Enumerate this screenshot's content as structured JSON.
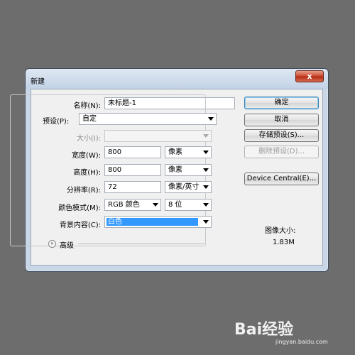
{
  "window": {
    "title": "新建",
    "close_label": "x"
  },
  "form": {
    "name": {
      "label": "名称(N):",
      "value": "未标题-1"
    },
    "preset": {
      "label": "预设(P):",
      "value": "自定"
    },
    "size": {
      "label": "大小(I):",
      "value": ""
    },
    "width": {
      "label": "宽度(W):",
      "value": "800",
      "unit": "像素"
    },
    "height": {
      "label": "高度(H):",
      "value": "800",
      "unit": "像素"
    },
    "resolution": {
      "label": "分辨率(R):",
      "value": "72",
      "unit": "像素/英寸"
    },
    "color_mode": {
      "label": "颜色模式(M):",
      "value": "RGB 颜色",
      "depth": "8 位"
    },
    "background": {
      "label": "背景内容(C):",
      "value": "白色"
    },
    "advanced_label": "高级",
    "advanced_icon": "double-chevron-down-icon"
  },
  "buttons": {
    "ok": "确定",
    "cancel": "取消",
    "save_preset": "存储预设(S)...",
    "delete_preset": "删除预设(D)...",
    "device_central": "Device Central(E)..."
  },
  "image_size": {
    "label": "图像大小:",
    "value": "1.83M"
  },
  "watermark": {
    "text": "Bai经验",
    "url": "jingyan.baidu.com"
  },
  "colors": {
    "background": "#6d6d6d",
    "dialog_frame": "#c9d6e6",
    "selection": "#3399ff",
    "close_button": "#c8452b"
  }
}
